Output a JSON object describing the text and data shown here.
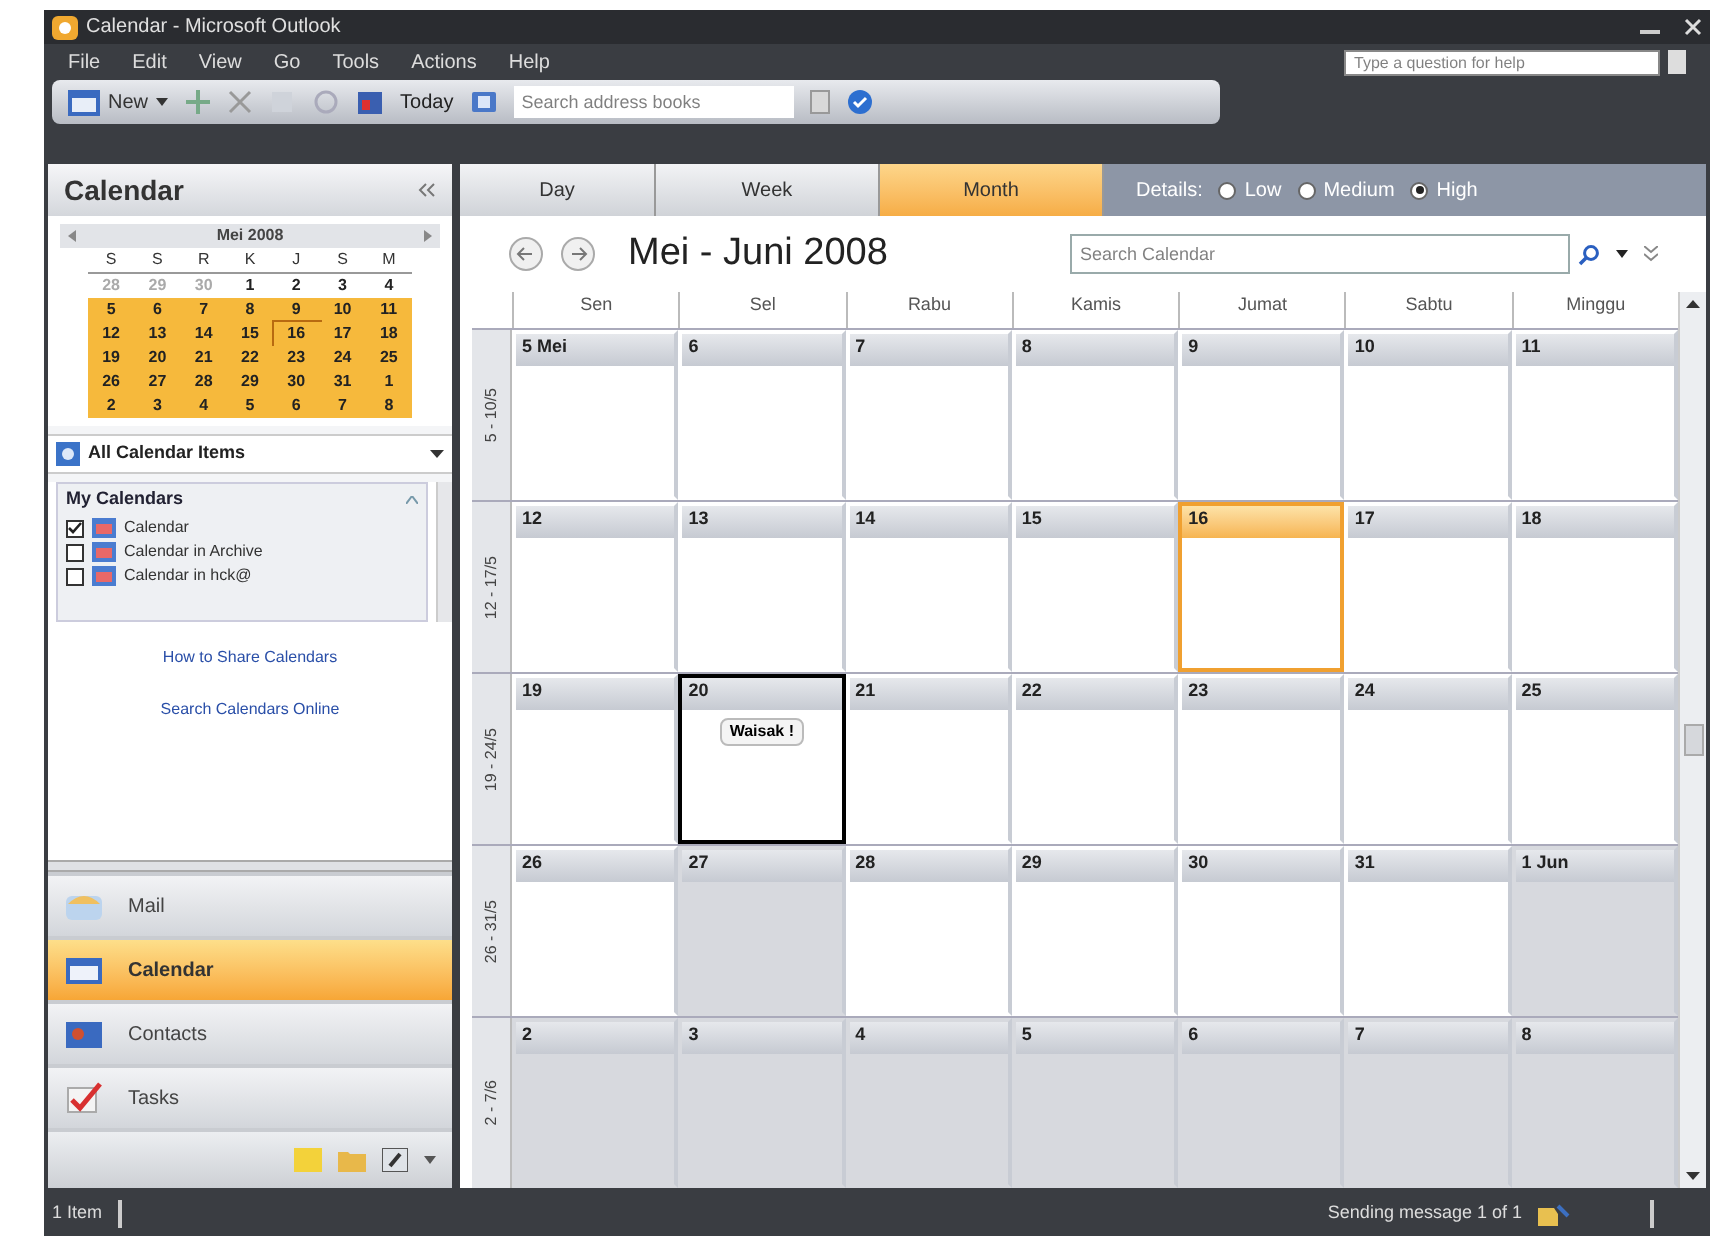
{
  "window": {
    "title": "Calendar - Microsoft Outlook"
  },
  "menu": [
    "File",
    "Edit",
    "View",
    "Go",
    "Tools",
    "Actions",
    "Help"
  ],
  "help_box": {
    "placeholder": "Type a question for help"
  },
  "toolbar": {
    "new_label": "New",
    "today_label": "Today",
    "search": {
      "placeholder": "Search address books"
    }
  },
  "navigation_pane": {
    "title": "Calendar",
    "mini_calendar": {
      "month": "Mei 2008",
      "weekdays": [
        "S",
        "S",
        "R",
        "K",
        "J",
        "S",
        "M"
      ],
      "weeks": [
        [
          {
            "day": "28",
            "muted": true,
            "in_range": false,
            "today": false
          },
          {
            "day": "29",
            "muted": true,
            "in_range": false,
            "today": false
          },
          {
            "day": "30",
            "muted": true,
            "in_range": false,
            "today": false
          },
          {
            "day": "1",
            "muted": false,
            "in_range": false,
            "today": false
          },
          {
            "day": "2",
            "muted": false,
            "in_range": false,
            "today": false
          },
          {
            "day": "3",
            "muted": false,
            "in_range": false,
            "today": false
          },
          {
            "day": "4",
            "muted": false,
            "in_range": false,
            "today": false
          }
        ],
        [
          {
            "day": "5",
            "muted": false,
            "in_range": true,
            "today": false
          },
          {
            "day": "6",
            "muted": false,
            "in_range": true,
            "today": false
          },
          {
            "day": "7",
            "muted": false,
            "in_range": true,
            "today": false
          },
          {
            "day": "8",
            "muted": false,
            "in_range": true,
            "today": false
          },
          {
            "day": "9",
            "muted": false,
            "in_range": true,
            "today": false
          },
          {
            "day": "10",
            "muted": false,
            "in_range": true,
            "today": false
          },
          {
            "day": "11",
            "muted": false,
            "in_range": true,
            "today": false
          }
        ],
        [
          {
            "day": "12",
            "muted": false,
            "in_range": true,
            "today": false
          },
          {
            "day": "13",
            "muted": false,
            "in_range": true,
            "today": false
          },
          {
            "day": "14",
            "muted": false,
            "in_range": true,
            "today": false
          },
          {
            "day": "15",
            "muted": false,
            "in_range": true,
            "today": false
          },
          {
            "day": "16",
            "muted": false,
            "in_range": true,
            "today": true
          },
          {
            "day": "17",
            "muted": false,
            "in_range": true,
            "today": false
          },
          {
            "day": "18",
            "muted": false,
            "in_range": true,
            "today": false
          }
        ],
        [
          {
            "day": "19",
            "muted": false,
            "in_range": true,
            "today": false
          },
          {
            "day": "20",
            "muted": false,
            "in_range": true,
            "today": false
          },
          {
            "day": "21",
            "muted": false,
            "in_range": true,
            "today": false
          },
          {
            "day": "22",
            "muted": false,
            "in_range": true,
            "today": false
          },
          {
            "day": "23",
            "muted": false,
            "in_range": true,
            "today": false
          },
          {
            "day": "24",
            "muted": false,
            "in_range": true,
            "today": false
          },
          {
            "day": "25",
            "muted": false,
            "in_range": true,
            "today": false
          }
        ],
        [
          {
            "day": "26",
            "muted": false,
            "in_range": true,
            "today": false
          },
          {
            "day": "27",
            "muted": false,
            "in_range": true,
            "today": false
          },
          {
            "day": "28",
            "muted": false,
            "in_range": true,
            "today": false
          },
          {
            "day": "29",
            "muted": false,
            "in_range": true,
            "today": false
          },
          {
            "day": "30",
            "muted": false,
            "in_range": true,
            "today": false
          },
          {
            "day": "31",
            "muted": false,
            "in_range": true,
            "today": false
          },
          {
            "day": "1",
            "muted": false,
            "in_range": true,
            "today": false
          }
        ],
        [
          {
            "day": "2",
            "muted": false,
            "in_range": true,
            "today": false
          },
          {
            "day": "3",
            "muted": false,
            "in_range": true,
            "today": false
          },
          {
            "day": "4",
            "muted": false,
            "in_range": true,
            "today": false
          },
          {
            "day": "5",
            "muted": false,
            "in_range": true,
            "today": false
          },
          {
            "day": "6",
            "muted": false,
            "in_range": true,
            "today": false
          },
          {
            "day": "7",
            "muted": false,
            "in_range": true,
            "today": false
          },
          {
            "day": "8",
            "muted": false,
            "in_range": true,
            "today": false
          }
        ]
      ]
    },
    "all_items": "All Calendar Items",
    "my_calendars": {
      "title": "My Calendars",
      "items": [
        {
          "label": "Calendar",
          "checked": true
        },
        {
          "label": "Calendar in Archive",
          "checked": false
        },
        {
          "label": "Calendar in hck@",
          "checked": false
        }
      ]
    },
    "links": [
      "How to Share Calendars",
      "Search Calendars Online"
    ],
    "buttons": [
      {
        "label": "Mail",
        "kind": "mail",
        "selected": false
      },
      {
        "label": "Calendar",
        "kind": "calendar",
        "selected": true
      },
      {
        "label": "Contacts",
        "kind": "contacts",
        "selected": false
      },
      {
        "label": "Tasks",
        "kind": "tasks",
        "selected": false
      }
    ]
  },
  "view_tabs": [
    {
      "label": "Day",
      "selected": false
    },
    {
      "label": "Week",
      "selected": false
    },
    {
      "label": "Month",
      "selected": true
    }
  ],
  "details": {
    "label": "Details:",
    "options": [
      {
        "label": "Low",
        "selected": false
      },
      {
        "label": "Medium",
        "selected": false
      },
      {
        "label": "High",
        "selected": true
      }
    ]
  },
  "range_title": "Mei - Juni 2008",
  "calendar_search": {
    "placeholder": "Search Calendar"
  },
  "weekday_headings": [
    "Sen",
    "Sel",
    "Rabu",
    "Kamis",
    "Jumat",
    "Sabtu",
    "Minggu"
  ],
  "weeks": [
    {
      "label": "5 - 10/5",
      "days": [
        {
          "label": "5 Mei",
          "shaded": false,
          "today": false,
          "selected": false
        },
        {
          "label": "6",
          "shaded": false,
          "today": false,
          "selected": false
        },
        {
          "label": "7",
          "shaded": false,
          "today": false,
          "selected": false
        },
        {
          "label": "8",
          "shaded": false,
          "today": false,
          "selected": false
        },
        {
          "label": "9",
          "shaded": false,
          "today": false,
          "selected": false
        },
        {
          "label": "10",
          "shaded": false,
          "today": false,
          "selected": false
        },
        {
          "label": "11",
          "shaded": false,
          "today": false,
          "selected": false
        }
      ]
    },
    {
      "label": "12 - 17/5",
      "days": [
        {
          "label": "12",
          "shaded": false,
          "today": false,
          "selected": false
        },
        {
          "label": "13",
          "shaded": false,
          "today": false,
          "selected": false
        },
        {
          "label": "14",
          "shaded": false,
          "today": false,
          "selected": false
        },
        {
          "label": "15",
          "shaded": false,
          "today": false,
          "selected": false
        },
        {
          "label": "16",
          "shaded": false,
          "today": true,
          "selected": false
        },
        {
          "label": "17",
          "shaded": false,
          "today": false,
          "selected": false
        },
        {
          "label": "18",
          "shaded": false,
          "today": false,
          "selected": false
        }
      ]
    },
    {
      "label": "19 - 24/5",
      "days": [
        {
          "label": "19",
          "shaded": false,
          "today": false,
          "selected": false
        },
        {
          "label": "20",
          "shaded": false,
          "today": false,
          "selected": true,
          "events": [
            "Waisak !"
          ]
        },
        {
          "label": "21",
          "shaded": false,
          "today": false,
          "selected": false
        },
        {
          "label": "22",
          "shaded": false,
          "today": false,
          "selected": false
        },
        {
          "label": "23",
          "shaded": false,
          "today": false,
          "selected": false
        },
        {
          "label": "24",
          "shaded": false,
          "today": false,
          "selected": false
        },
        {
          "label": "25",
          "shaded": false,
          "today": false,
          "selected": false
        }
      ]
    },
    {
      "label": "26 - 31/5",
      "days": [
        {
          "label": "26",
          "shaded": false,
          "today": false,
          "selected": false
        },
        {
          "label": "27",
          "shaded": true,
          "today": false,
          "selected": false
        },
        {
          "label": "28",
          "shaded": false,
          "today": false,
          "selected": false
        },
        {
          "label": "29",
          "shaded": false,
          "today": false,
          "selected": false
        },
        {
          "label": "30",
          "shaded": false,
          "today": false,
          "selected": false
        },
        {
          "label": "31",
          "shaded": false,
          "today": false,
          "selected": false
        },
        {
          "label": "1 Jun",
          "shaded": true,
          "today": false,
          "selected": false
        }
      ]
    },
    {
      "label": "2 - 7/6",
      "days": [
        {
          "label": "2",
          "shaded": true,
          "today": false,
          "selected": false
        },
        {
          "label": "3",
          "shaded": true,
          "today": false,
          "selected": false
        },
        {
          "label": "4",
          "shaded": true,
          "today": false,
          "selected": false
        },
        {
          "label": "5",
          "shaded": true,
          "today": false,
          "selected": false
        },
        {
          "label": "6",
          "shaded": true,
          "today": false,
          "selected": false
        },
        {
          "label": "7",
          "shaded": true,
          "today": false,
          "selected": false
        },
        {
          "label": "8",
          "shaded": true,
          "today": false,
          "selected": false
        }
      ]
    }
  ],
  "status_bar": {
    "items": "1 Item",
    "message": "Sending message 1 of 1"
  }
}
